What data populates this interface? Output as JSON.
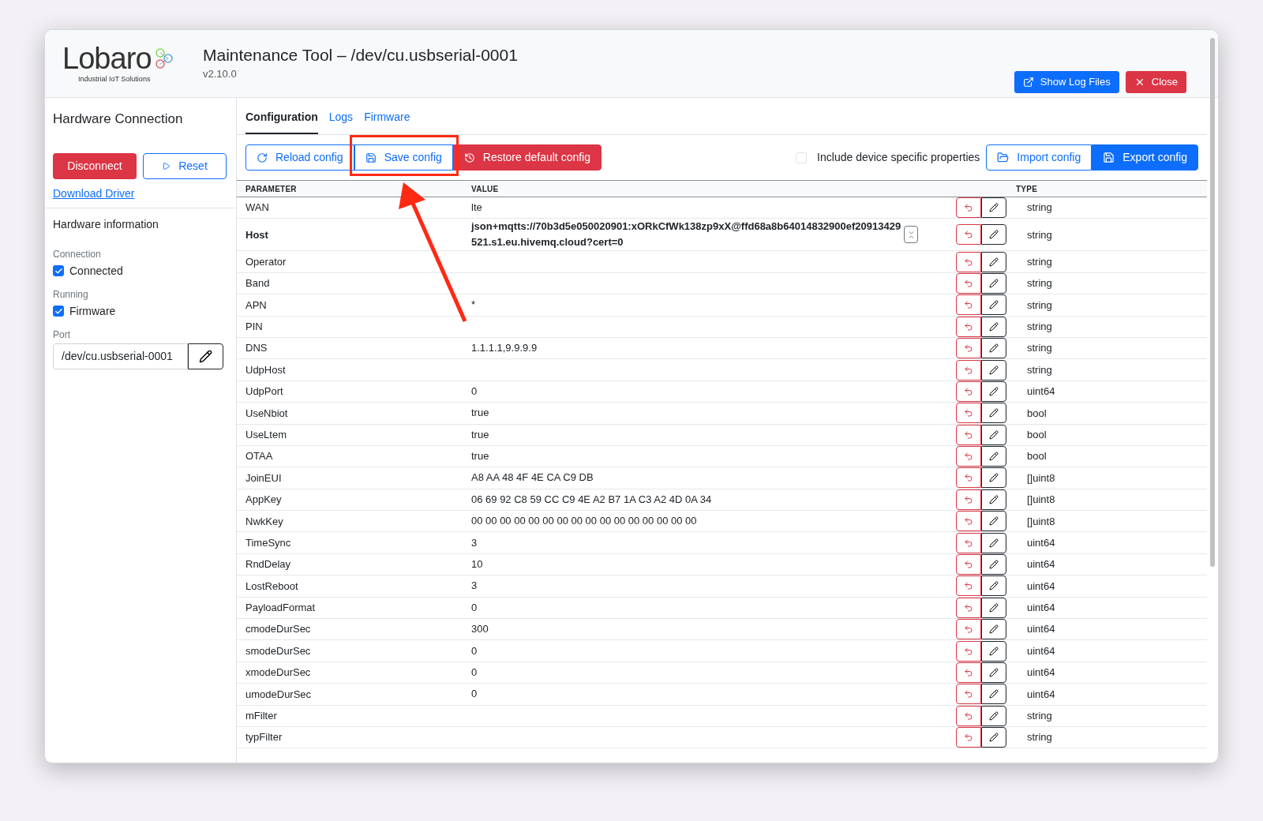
{
  "app": {
    "logo_text": "Lobaro",
    "logo_tagline": "Industrial IoT Solutions",
    "title": "Maintenance Tool – /dev/cu.usbserial-0001",
    "version": "v2.10.0",
    "buttons": [
      {
        "label": "Show Log Files",
        "kind": "primary"
      },
      {
        "label": "Close",
        "kind": "danger"
      }
    ]
  },
  "sidebar": {
    "title": "Hardware Connection",
    "disconnect": "Disconnect",
    "reset": "Reset",
    "driver_link": "Download Driver",
    "info_title": "Hardware information",
    "groups": [
      {
        "label": "Connection",
        "check": "Connected",
        "checked": true
      },
      {
        "label": "Running",
        "check": "Firmware",
        "checked": true
      }
    ],
    "port_label": "Port",
    "port_value": "/dev/cu.usbserial-0001"
  },
  "tabs": [
    {
      "label": "Configuration",
      "selected": true
    },
    {
      "label": "Logs",
      "selected": false
    },
    {
      "label": "Firmware",
      "selected": false
    }
  ],
  "toolbar": {
    "left": [
      {
        "label": "Reload config",
        "kind": "outline"
      },
      {
        "label": "Save config",
        "kind": "outline"
      },
      {
        "label": "Restore default config",
        "kind": "danger"
      }
    ],
    "include_label": "Include device specific properties",
    "include_checked": false,
    "right": [
      {
        "label": "Import config",
        "kind": "outline"
      },
      {
        "label": "Export config",
        "kind": "primary"
      }
    ]
  },
  "table": {
    "columns": [
      "PARAMETER",
      "VALUE",
      "TYPE"
    ],
    "rows": [
      {
        "parameter": "WAN",
        "value": "lte",
        "type": "string",
        "modified": false
      },
      {
        "parameter": "Host",
        "value": "json+mqtts://70b3d5e050020901:xORkCfWk138zp9xX@ffd68a8b64014832900ef20913429521.s1.eu.hivemq.cloud?cert=0",
        "type": "string",
        "modified": true
      },
      {
        "parameter": "Operator",
        "value": "",
        "type": "string",
        "modified": false
      },
      {
        "parameter": "Band",
        "value": "",
        "type": "string",
        "modified": false
      },
      {
        "parameter": "APN",
        "value": "*",
        "type": "string",
        "modified": false
      },
      {
        "parameter": "PIN",
        "value": "",
        "type": "string",
        "modified": false
      },
      {
        "parameter": "DNS",
        "value": "1.1.1.1,9.9.9.9",
        "type": "string",
        "modified": false
      },
      {
        "parameter": "UdpHost",
        "value": "",
        "type": "string",
        "modified": false
      },
      {
        "parameter": "UdpPort",
        "value": "0",
        "type": "uint64",
        "modified": false
      },
      {
        "parameter": "UseNbiot",
        "value": "true",
        "type": "bool",
        "modified": false
      },
      {
        "parameter": "UseLtem",
        "value": "true",
        "type": "bool",
        "modified": false
      },
      {
        "parameter": "OTAA",
        "value": "true",
        "type": "bool",
        "modified": false
      },
      {
        "parameter": "JoinEUI",
        "value": "A8 AA 48 4F 4E CA C9 DB",
        "type": "[]uint8",
        "modified": false
      },
      {
        "parameter": "AppKey",
        "value": "06 69 92 C8 59 CC C9 4E A2 B7 1A C3 A2 4D 0A 34",
        "type": "[]uint8",
        "modified": false
      },
      {
        "parameter": "NwkKey",
        "value": "00 00 00 00 00 00 00 00 00 00 00 00 00 00 00 00",
        "type": "[]uint8",
        "modified": false
      },
      {
        "parameter": "TimeSync",
        "value": "3",
        "type": "uint64",
        "modified": false
      },
      {
        "parameter": "RndDelay",
        "value": "10",
        "type": "uint64",
        "modified": false
      },
      {
        "parameter": "LostReboot",
        "value": "3",
        "type": "uint64",
        "modified": false
      },
      {
        "parameter": "PayloadFormat",
        "value": "0",
        "type": "uint64",
        "modified": false
      },
      {
        "parameter": "cmodeDurSec",
        "value": "300",
        "type": "uint64",
        "modified": false
      },
      {
        "parameter": "smodeDurSec",
        "value": "0",
        "type": "uint64",
        "modified": false
      },
      {
        "parameter": "xmodeDurSec",
        "value": "0",
        "type": "uint64",
        "modified": false
      },
      {
        "parameter": "umodeDurSec",
        "value": "0",
        "type": "uint64",
        "modified": false
      },
      {
        "parameter": "mFilter",
        "value": "",
        "type": "string",
        "modified": false
      },
      {
        "parameter": "typFilter",
        "value": "",
        "type": "string",
        "modified": false
      }
    ]
  }
}
